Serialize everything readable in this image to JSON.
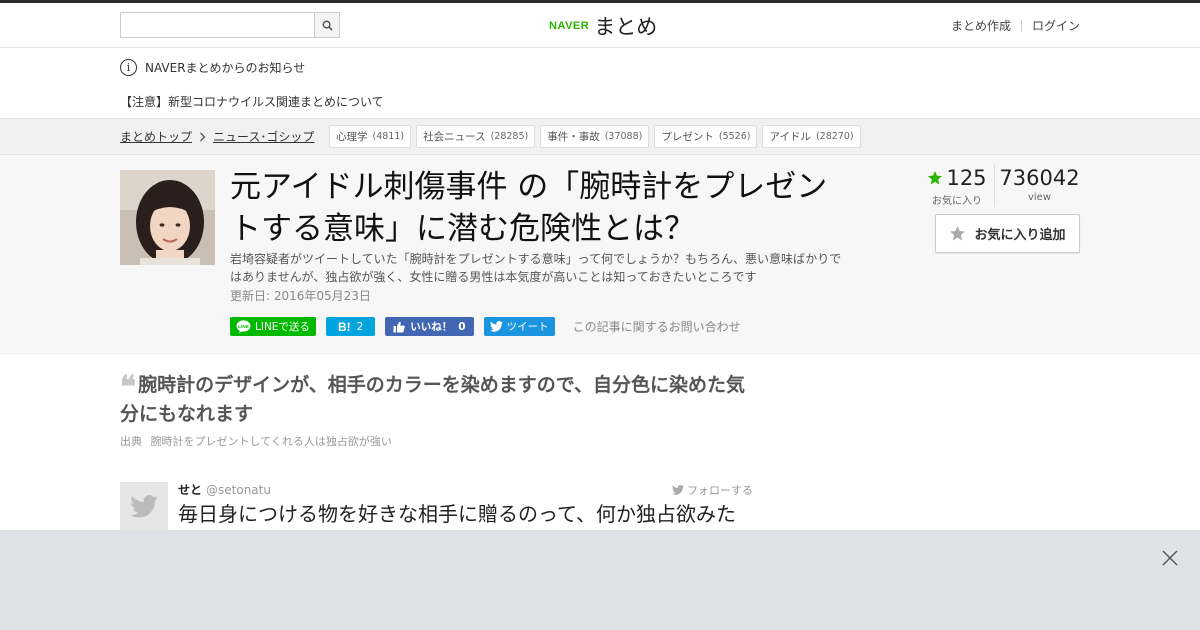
{
  "header": {
    "search_placeholder": "",
    "logo_naver": "NAVER",
    "logo_matome": "まとめ",
    "create_label": "まとめ作成",
    "login_label": "ログイン"
  },
  "notice": {
    "icon_char": "i",
    "title": "NAVERまとめからのお知らせ",
    "link": "【注意】新型コロナウイルス関連まとめについて"
  },
  "breadcrumb": {
    "items": [
      "まとめトップ",
      "ニュース･ゴシップ"
    ]
  },
  "tags": [
    {
      "name": "心理学",
      "count": "(4811)"
    },
    {
      "name": "社会ニュース",
      "count": "(28285)"
    },
    {
      "name": "事件・事故",
      "count": "(37088)"
    },
    {
      "name": "プレゼント",
      "count": "(5526)"
    },
    {
      "name": "アイドル",
      "count": "(28270)"
    }
  ],
  "article": {
    "title": "元アイドル刺傷事件 の「腕時計をプレゼントする意味」に潜む危険性とは？",
    "description": "岩埼容疑者がツイートしていた「腕時計をプレゼントする意味」って何でしょうか？もちろん、悪い意味ばかりではありませんが、独占欲が強く、女性に贈る男性は本気度が高いことは知っておきたいところです",
    "updated": "更新日: 2016年05月23日",
    "favorites": "125",
    "favorites_label": "お気に入り",
    "views": "736042",
    "views_label": "view",
    "fav_button": "お気に入り追加"
  },
  "share": {
    "line": "LINEで送る",
    "hatena_mark": "B!",
    "hatena_count": "2",
    "fb_like": "いいね！",
    "fb_count": "0",
    "tweet": "ツイート",
    "contact": "この記事に関するお問い合わせ"
  },
  "content": {
    "quote": "腕時計のデザインが、相手のカラーを染めますので、自分色に染めた気分にもなれます",
    "source_label": "出典",
    "source_title": "腕時計をプレゼントしてくれる人は独占欲が強い",
    "tweet_name": "せと",
    "tweet_handle": "@setonatu",
    "tweet_follow": "フォローする",
    "tweet_text": "毎日身につける物を好きな相手に贈るのって、何か独占欲みた"
  },
  "colors": {
    "naver_green": "#2db400",
    "star_green": "#2db400",
    "line_green": "#00b900",
    "hatena_blue": "#00a4de",
    "fb_blue": "#4267b2",
    "twitter_blue": "#1b95e0",
    "ad_gray": "#dfe3e8"
  }
}
